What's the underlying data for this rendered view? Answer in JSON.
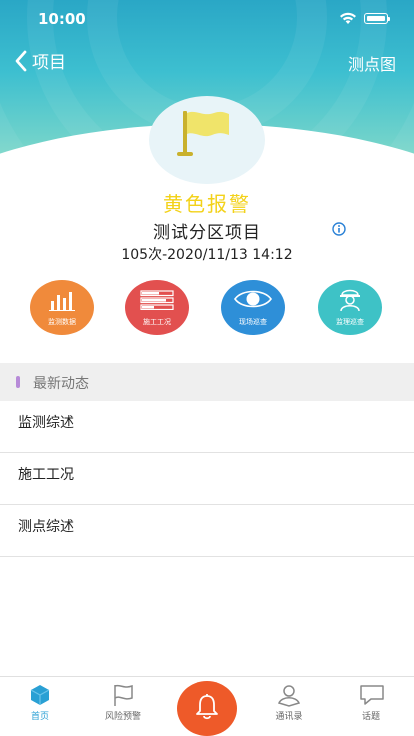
{
  "status_bar": {
    "time": "10:00"
  },
  "nav": {
    "back_label": "项目",
    "right_label": "测点图"
  },
  "alarm": {
    "level": "黄色报警",
    "color": "#f3d21a"
  },
  "project": {
    "name": "测试分区项目",
    "meta": "105次-2020/11/13 14:12"
  },
  "actions": [
    {
      "label": "监测数据",
      "icon": "bar-chart-icon",
      "color": "#f08a3b"
    },
    {
      "label": "施工工况",
      "icon": "list-icon",
      "color": "#e2504f"
    },
    {
      "label": "现场巡查",
      "icon": "eye-icon",
      "color": "#2e8fd8"
    },
    {
      "label": "监理巡查",
      "icon": "inspector-icon",
      "color": "#3ec2c6"
    }
  ],
  "section": {
    "title": "最新动态"
  },
  "list": [
    {
      "label": "监测综述"
    },
    {
      "label": "施工工况"
    },
    {
      "label": "测点综述"
    }
  ],
  "tabbar": {
    "tabs": [
      {
        "label": "首页",
        "icon": "home-icon",
        "active": true
      },
      {
        "label": "风险预警",
        "icon": "flag-icon",
        "active": false
      },
      {
        "label": "通讯录",
        "icon": "contacts-icon",
        "active": false
      },
      {
        "label": "话题",
        "icon": "chat-icon",
        "active": false
      }
    ],
    "center_icon": "bell-icon",
    "accent_color": "#2aa0d4"
  }
}
